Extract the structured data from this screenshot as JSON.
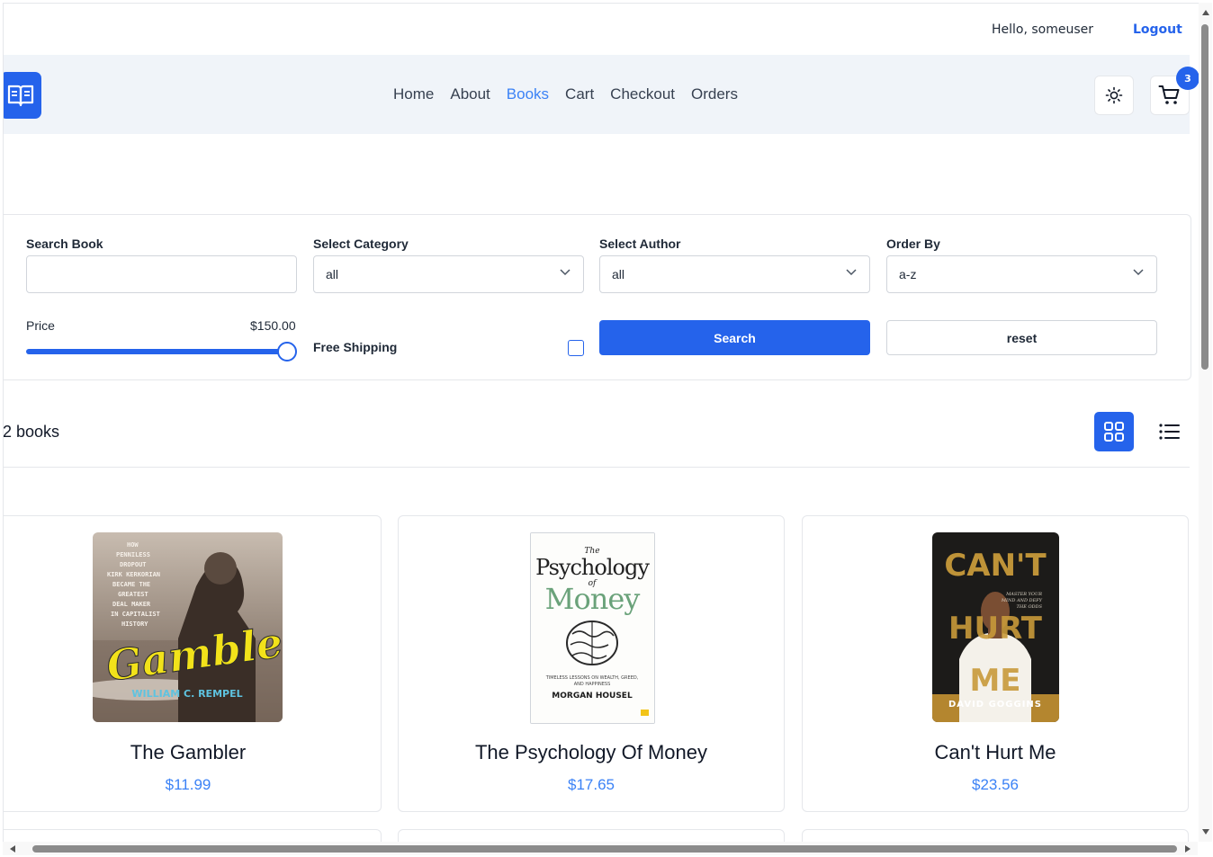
{
  "userbar": {
    "greeting": "Hello, someuser",
    "logout_label": "Logout"
  },
  "navbar": {
    "links": [
      "Home",
      "About",
      "Books",
      "Cart",
      "Checkout",
      "Orders"
    ],
    "active": "Books",
    "cart_count": "3"
  },
  "filters": {
    "search_label": "Search Book",
    "search_value": "",
    "category_label": "Select Category",
    "category_value": "all",
    "author_label": "Select Author",
    "author_value": "all",
    "order_label": "Order By",
    "order_value": "a-z",
    "price_label": "Price",
    "price_value": "$150.00",
    "price_fraction": 1.0,
    "shipping_label": "Free Shipping",
    "shipping_checked": false,
    "search_button": "Search",
    "reset_button": "reset"
  },
  "results": {
    "count_text": "2 books",
    "view_mode": "grid"
  },
  "books": [
    {
      "title": "The Gambler",
      "price": "$11.99",
      "cover_author": "WILLIAM C. REMPEL",
      "cover_title": "Gambler"
    },
    {
      "title": "The Psychology Of Money",
      "price": "$17.65",
      "cover_author": "MORGAN HOUSEL",
      "cover_title": "Psychology of Money"
    },
    {
      "title": "Can't Hurt Me",
      "price": "$23.56",
      "cover_author": "DAVID GOGGINS",
      "cover_title": "CAN'T HURT ME"
    }
  ],
  "colors": {
    "accent": "#2563eb",
    "link": "#3b82f6",
    "nav_bg": "#f0f4f9"
  },
  "icons": {
    "logo": "open-book-icon",
    "theme": "sun-icon",
    "cart": "cart-icon",
    "grid": "grid-icon",
    "list": "list-icon"
  }
}
